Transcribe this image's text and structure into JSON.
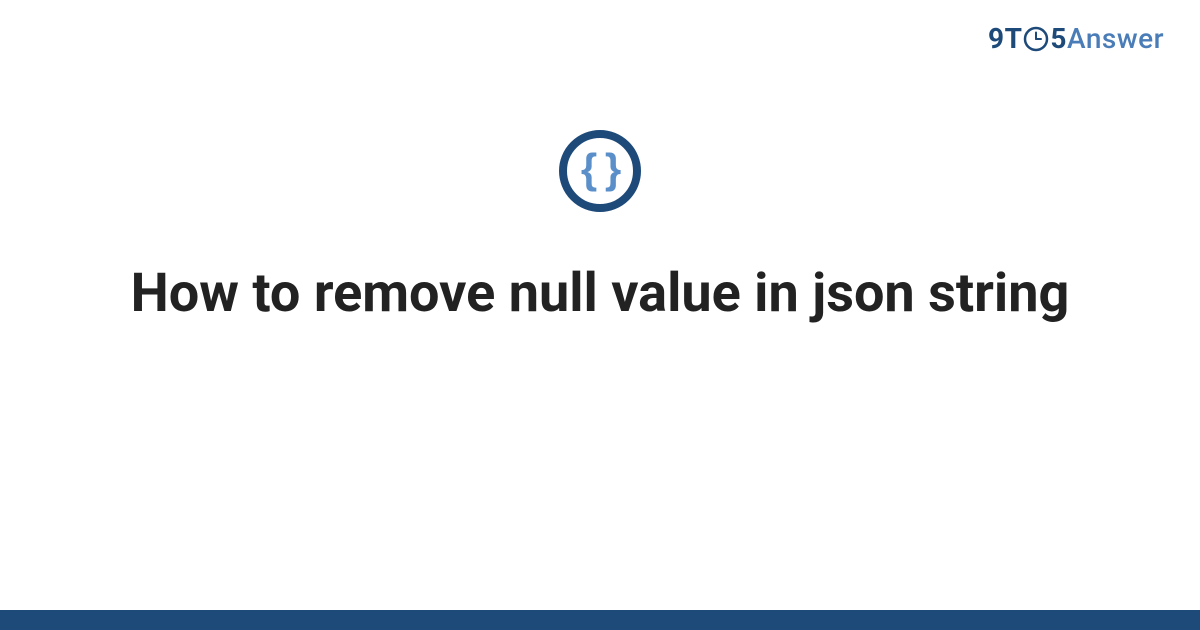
{
  "logo": {
    "part1": "9T",
    "part2": "5",
    "part3": "Answer"
  },
  "icon": {
    "name": "json-braces-icon",
    "glyph": "{ }"
  },
  "title": "How to remove null value in json string",
  "colors": {
    "primary": "#1e4a7a",
    "accent": "#5a8fc9",
    "logo_light": "#4a7db8",
    "text": "#222222"
  }
}
